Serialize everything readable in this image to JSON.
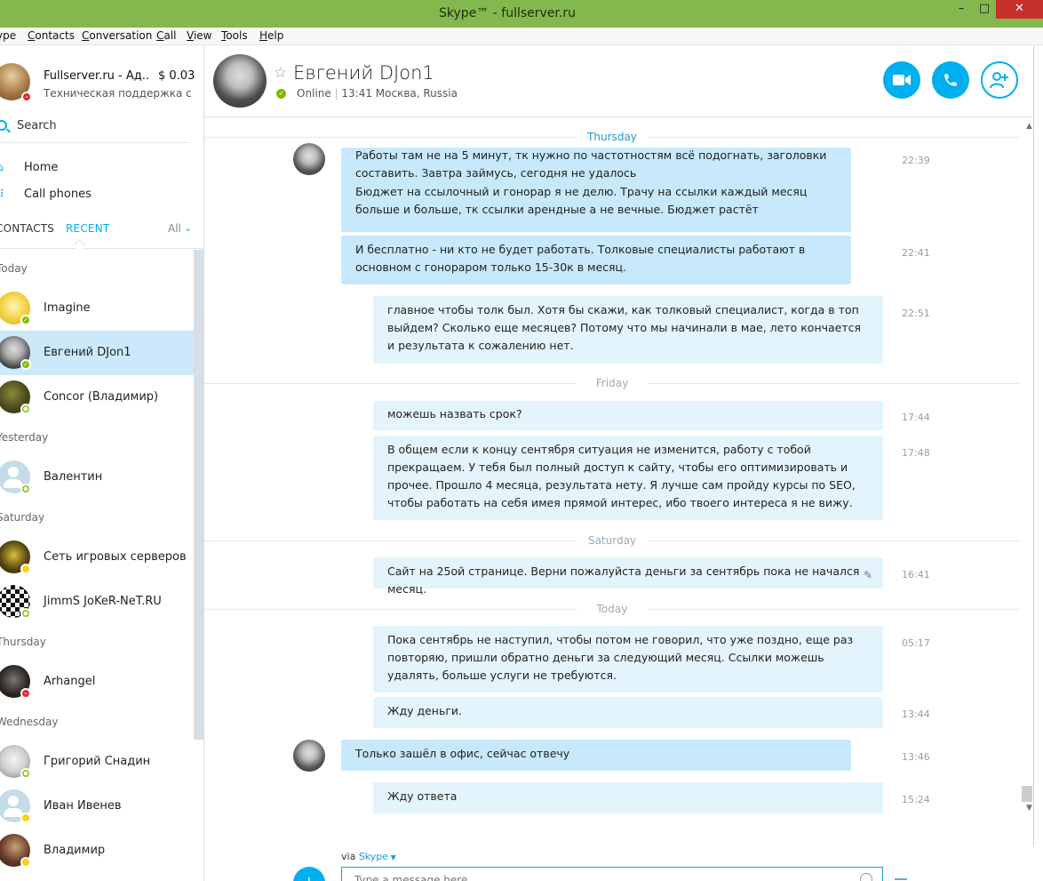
{
  "window": {
    "title": "Skype™ - fullserver.ru",
    "min": "–",
    "max": "□",
    "close": "✕"
  },
  "menu": [
    {
      "pre": "",
      "key": "",
      "post": "ype"
    },
    {
      "pre": "",
      "key": "C",
      "post": "ontacts"
    },
    {
      "pre": "",
      "key": "C",
      "post": "onversation"
    },
    {
      "pre": "",
      "key": "C",
      "post": "all"
    },
    {
      "pre": "",
      "key": "V",
      "post": "iew"
    },
    {
      "pre": "",
      "key": "T",
      "post": "ools"
    },
    {
      "pre": "",
      "key": "H",
      "post": "elp"
    }
  ],
  "me": {
    "name": "Fullserver.ru - Ад...",
    "credit": "$ 0.03",
    "mood": "Техническая поддержка с По...",
    "status": "dnd"
  },
  "search": {
    "label": "Search"
  },
  "nav": {
    "home": "Home",
    "call_phones": "Call phones"
  },
  "tabs": {
    "contacts": "CONTACTS",
    "recent": "RECENT",
    "filter": "All"
  },
  "groups": {
    "today": "Today",
    "yesterday": "Yesterday",
    "saturday": "Saturday",
    "thursday": "Thursday",
    "wednesday": "Wednesday"
  },
  "contacts": [
    {
      "name": "Imagine",
      "status": "online"
    },
    {
      "name": "Евгений DJon1",
      "status": "online"
    },
    {
      "name": "Concor (Владимир)",
      "status": "offline"
    },
    {
      "name": "Валентин",
      "status": "offline"
    },
    {
      "name": "Сеть игровых серверов",
      "status": "away"
    },
    {
      "name": "JimmS JoKeR-NeT.RU",
      "status": "offline"
    },
    {
      "name": "Arhangel",
      "status": "dnd"
    },
    {
      "name": "Григорий  Снадин",
      "status": "offline"
    },
    {
      "name": "Иван Ивенев",
      "status": "away"
    },
    {
      "name": "Владимир",
      "status": "away"
    }
  ],
  "conversation": {
    "name": "Евгений DJon1",
    "status": "Online",
    "location": "13:41 Москва, Russia",
    "days": [
      "Thursday",
      "Friday",
      "Saturday",
      "Today"
    ],
    "messages": [
      {
        "lines": [
          "Работы там не на 5 минут, тк нужно по частотностям всё подогнать, заголовки составить. Завтра займусь, сегодня не удалось",
          "Бюджет на ссылочный и гонорар я не делю. Трачу на ссылки каждый месяц больше и больше, тк ссылки арендные а не вечные. Бюджет растёт"
        ],
        "time": "22:39"
      },
      {
        "lines": [
          "И бесплатно - ни кто не будет работать. Толковые специалисты работают в основном с гонораром только 15-30к в месяц."
        ],
        "time": "22:41"
      },
      {
        "lines": [
          "главное чтобы толк был. Хотя бы скажи, как толковый специалист, когда в топ выйдем? Сколько еще месяцев? Потому что мы начинали в мае, лето кончается и результата к сожалению нет."
        ],
        "time": "22:51"
      },
      {
        "lines": [
          "можешь назвать срок?"
        ],
        "time": "17:44"
      },
      {
        "lines": [
          "В общем если к концу сентября ситуация не изменится, работу с тобой прекращаем. У тебя был полный доступ к сайту, чтобы его оптимизировать и прочее. Прошло 4 месяца, результата нету. Я лучше сам пройду курсы по SEO, чтобы работать на себя имея прямой интерес, ибо твоего интереса я не вижу."
        ],
        "time": "17:48"
      },
      {
        "lines": [
          "Сайт на 25ой странице. Верни пожалуйста деньги за сентябрь пока не начался месяц."
        ],
        "time": "16:41"
      },
      {
        "lines": [
          "Пока сентябрь не наступил, чтобы потом не говорил, что уже поздно, еще раз повторяю, пришли обратно деньги за следующий месяц. Ссылки можешь удалять, больше услуги не требуются."
        ],
        "time": "05:17"
      },
      {
        "lines": [
          "Жду деньги."
        ],
        "time": "13:44"
      },
      {
        "lines": [
          "Только зашёл в офис, сейчас отвечу"
        ],
        "time": "13:46"
      },
      {
        "lines": [
          "Жду ответа"
        ],
        "time": "15:24"
      }
    ]
  },
  "compose": {
    "via": "via",
    "via_service": "Skype",
    "placeholder": "Type a message here"
  },
  "colors": {
    "accent": "#00aff0",
    "titlebar": "#83b84e",
    "incoming": "#c7e9fb",
    "outgoing": "#e4f4fc",
    "online": "#7fba00",
    "dnd": "#e4272a",
    "away": "#fcd116"
  },
  "icons": {
    "search": "search-icon",
    "home": "home-icon",
    "dialpad": "dialpad-icon",
    "video": "video-call-icon",
    "phone": "phone-icon",
    "add_contact": "add-contact-icon",
    "attach": "attach-icon",
    "emoji": "emoji-icon",
    "star": "favorite-star-icon"
  }
}
